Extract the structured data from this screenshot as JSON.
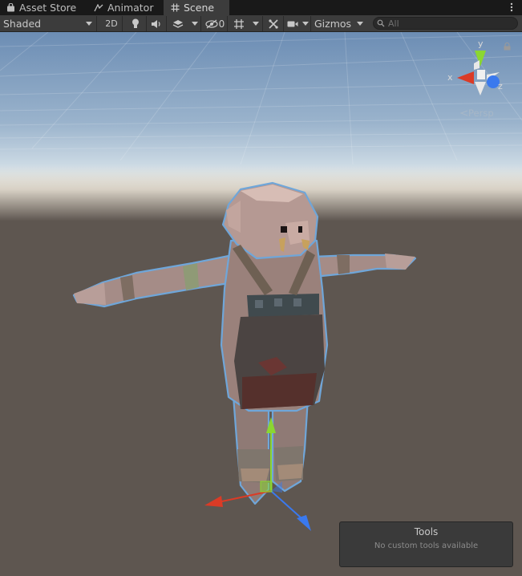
{
  "tabs": [
    {
      "label": "Asset Store",
      "icon": "shopping-bag-icon"
    },
    {
      "label": "Animator",
      "icon": "animator-icon"
    },
    {
      "label": "Scene",
      "icon": "grid-icon",
      "active": true
    }
  ],
  "toolbar": {
    "shading_mode": "Shaded",
    "toggle_2d": "2D",
    "hidden_count": "0",
    "gizmos_label": "Gizmos",
    "search_placeholder": "All",
    "icons": [
      "lighting-bulb-icon",
      "audio-icon",
      "effects-icon",
      "scene-visibility-icon",
      "grid-snap-icon",
      "tools-icon",
      "camera-icon"
    ]
  },
  "scene_gizmo": {
    "axis_y": "y",
    "axis_x": "x",
    "axis_z": "z",
    "projection_label": "Persp",
    "axis_colors": {
      "x": "#db3b26",
      "y": "#8bd631",
      "z": "#3a79ee"
    }
  },
  "tools_overlay": {
    "title": "Tools",
    "message": "No custom tools available"
  }
}
